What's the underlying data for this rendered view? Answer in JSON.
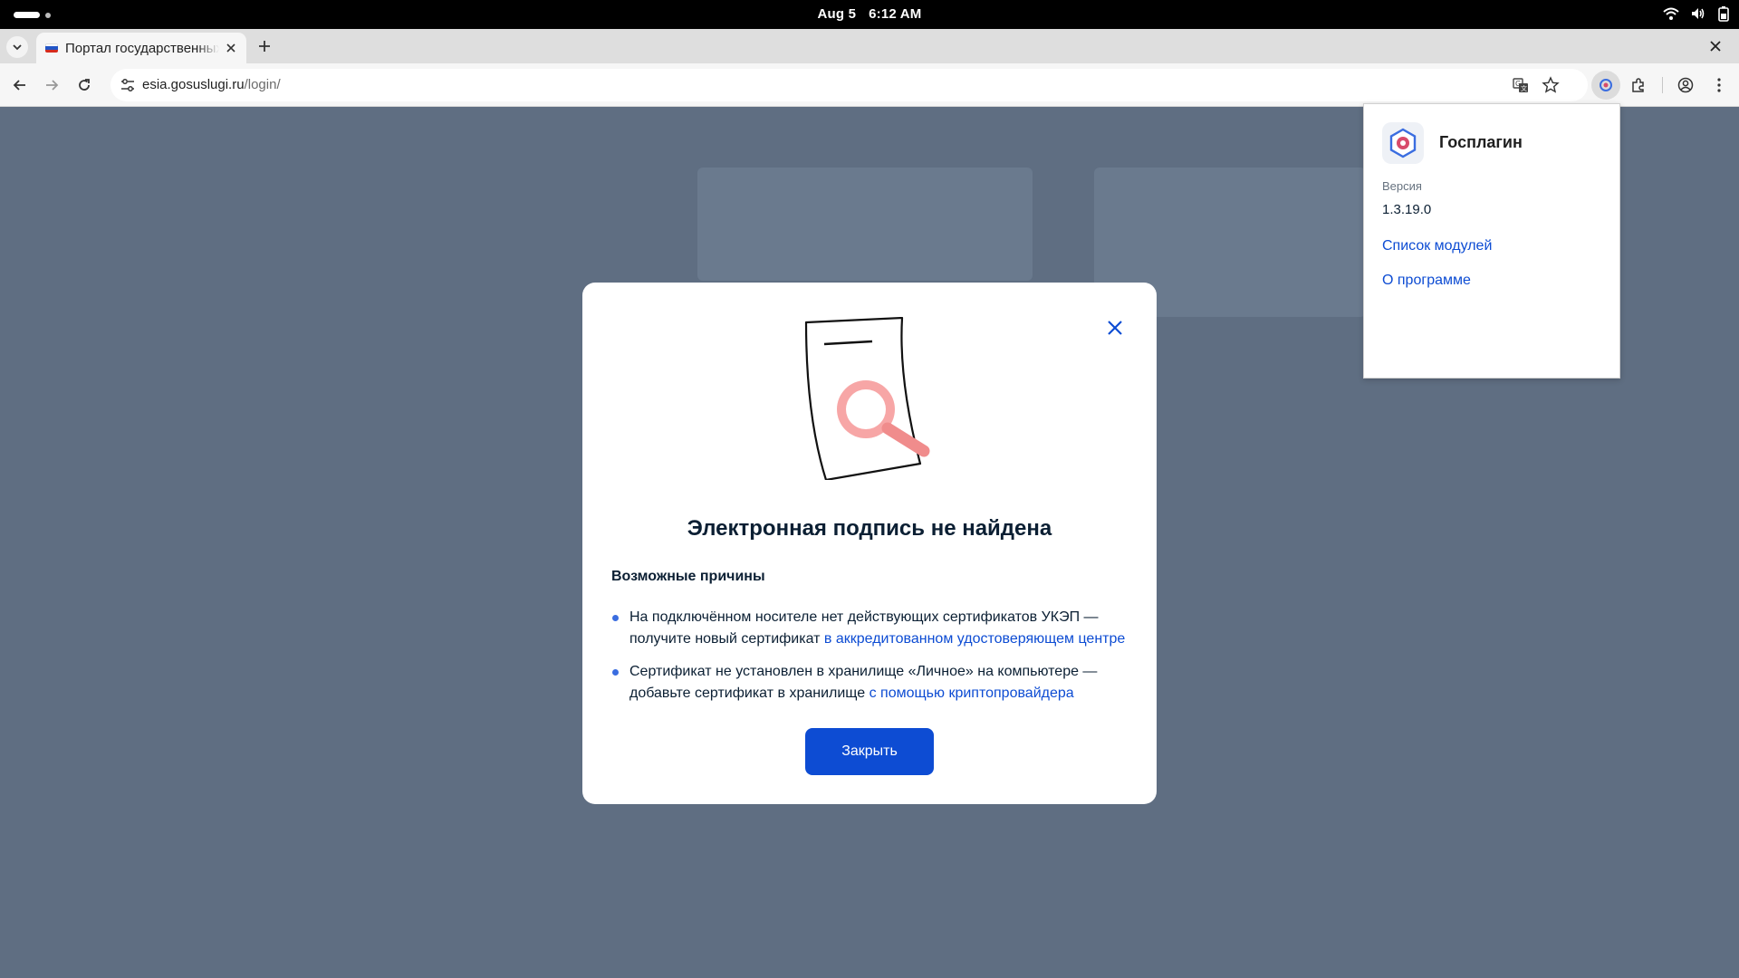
{
  "os": {
    "date": "Aug 5",
    "time": "6:12 AM"
  },
  "browser": {
    "tab_title": "Портал государственных услуг",
    "url_host": "esia.gosuslugi.ru",
    "url_path": "/login/"
  },
  "modal": {
    "title": "Электронная подпись не найдена",
    "reasons_heading": "Возможные причины",
    "reasons": [
      {
        "text": "На подключённом носителе нет действующих сертификатов УКЭП — получите новый сертификат ",
        "link": "в аккредитованном удостоверяющем центре"
      },
      {
        "text": "Сертификат не установлен в хранилище «Личное» на компьютере — добавьте сертификат в хранилище ",
        "link": "с помощью криптопровайдера"
      }
    ],
    "button_label": "Закрыть"
  },
  "extension_popup": {
    "name": "Госплагин",
    "version_label": "Версия",
    "version": "1.3.19.0",
    "links": [
      "Список модулей",
      "О программе"
    ]
  },
  "colors": {
    "accent": "#0d4cd3",
    "overlay_background": "#5f6e82",
    "illustration_pink": "#f4a0a0"
  },
  "icons": [
    "wifi-icon",
    "volume-icon",
    "battery-icon",
    "chevron-down-icon",
    "close-icon",
    "plus-icon",
    "back-icon",
    "forward-icon",
    "reload-icon",
    "site-settings-icon",
    "translate-icon",
    "star-icon",
    "gosplugin-icon",
    "extensions-icon",
    "profile-icon",
    "menu-icon"
  ]
}
